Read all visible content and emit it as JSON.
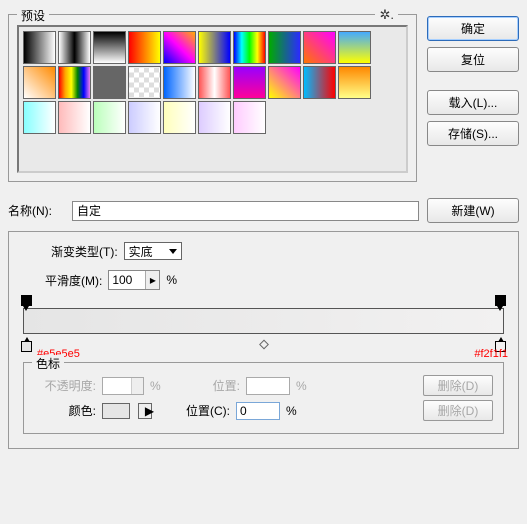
{
  "presets": {
    "title": "预设"
  },
  "buttons": {
    "ok": "确定",
    "reset": "复位",
    "load": "载入(L)...",
    "save": "存储(S)...",
    "new": "新建(W)"
  },
  "name": {
    "label": "名称(N):",
    "value": "自定"
  },
  "gradType": {
    "label": "渐变类型(T):",
    "value": "实底"
  },
  "smooth": {
    "label": "平滑度(M):",
    "value": "100",
    "unit": "%"
  },
  "anno": {
    "left": "#e5e5e5",
    "right": "#f2f1f1"
  },
  "stops": {
    "title": "色标",
    "opacity": {
      "label": "不透明度:",
      "unit": "%"
    },
    "pos": {
      "label": "位置:",
      "unit": "%"
    },
    "del": "删除(D)",
    "color": {
      "label": "颜色:"
    },
    "pos2": {
      "label": "位置(C):",
      "value": "0",
      "unit": "%"
    }
  },
  "gradients": [
    "linear-gradient(to right,#000,#fff)",
    "linear-gradient(to right,#fff,#000,#fff)",
    "linear-gradient(to bottom,#000,#fff)",
    "linear-gradient(to right,#f00,#ff0)",
    "linear-gradient(45deg,#00f,#f0f,#fa0)",
    "linear-gradient(to right,#ff0,#00f)",
    "linear-gradient(to right,#00f,#0ff,#0f0,#ff0,#f00)",
    "linear-gradient(to right,#0a0,#2b2bff)",
    "linear-gradient(45deg,#f70,#f0f)",
    "linear-gradient(to bottom,#4af,#ff0)",
    "linear-gradient(45deg,#fff,#ff8a00)",
    "linear-gradient(to right,red,orange,yellow,green,blue,violet)",
    "linear-gradient(to right,#666,#666)",
    "repeating-conic-gradient(#ddd 0 25%,#fff 0 50%) 0/10px 10px",
    "linear-gradient(to right,#06f,#fff)",
    "linear-gradient(to right,#f55,#fff,#f55)",
    "linear-gradient(to bottom,#90f,#f09)",
    "linear-gradient(45deg,#ff0,#f0f)",
    "linear-gradient(to right,#0bf,#f00)",
    "linear-gradient(to bottom,#f80,#ff8)",
    "linear-gradient(to right,#8ff,#fff)",
    "linear-gradient(to right,#fbb,#fff)",
    "linear-gradient(to right,#bfb,#fff)",
    "linear-gradient(to right,#ccf,#fff)",
    "linear-gradient(to right,#ffb,#fff)",
    "linear-gradient(to right,#dcf,#fff)",
    "linear-gradient(to right,#fcf,#fff)"
  ]
}
